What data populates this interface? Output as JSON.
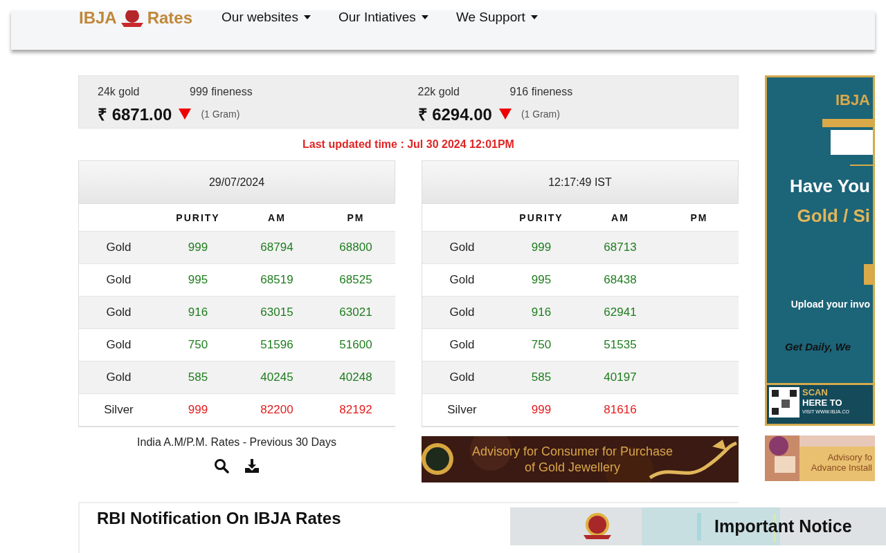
{
  "header": {
    "logo": {
      "left": "IBJA",
      "right": "Rates"
    },
    "nav": [
      {
        "label": "Our websites"
      },
      {
        "label": "Our Intiatives"
      },
      {
        "label": "We Support"
      }
    ]
  },
  "prices": [
    {
      "karat": "24k gold",
      "fineness": "999 fineness",
      "currency": "₹",
      "price": "6871.00",
      "falling": true,
      "unit": "(1 Gram)"
    },
    {
      "karat": "22k gold",
      "fineness": "916 fineness",
      "currency": "₹",
      "price": "6294.00",
      "falling": true,
      "unit": "(1 Gram)"
    }
  ],
  "last_updated": "Last updated time : Jul 30 2024 12:01PM",
  "tables": [
    {
      "title": "29/07/2024",
      "columns": [
        "PURITY",
        "AM",
        "PM"
      ],
      "rows": [
        {
          "metal": "Gold",
          "purity": "999",
          "am": "68794",
          "pm": "68800",
          "color": "#1e7d1e"
        },
        {
          "metal": "Gold",
          "purity": "995",
          "am": "68519",
          "pm": "68525",
          "color": "#1e7d1e"
        },
        {
          "metal": "Gold",
          "purity": "916",
          "am": "63015",
          "pm": "63021",
          "color": "#1e7d1e"
        },
        {
          "metal": "Gold",
          "purity": "750",
          "am": "51596",
          "pm": "51600",
          "color": "#1e7d1e"
        },
        {
          "metal": "Gold",
          "purity": "585",
          "am": "40245",
          "pm": "40248",
          "color": "#1e7d1e"
        },
        {
          "metal": "Silver",
          "purity": "999",
          "am": "82200",
          "pm": "82192",
          "color": "#e41b1b"
        }
      ]
    },
    {
      "title": "12:17:49 IST",
      "columns": [
        "PURITY",
        "AM",
        "PM"
      ],
      "rows": [
        {
          "metal": "Gold",
          "purity": "999",
          "am": "68713",
          "color": "#1e7d1e"
        },
        {
          "metal": "Gold",
          "purity": "995",
          "am": "68438",
          "color": "#1e7d1e"
        },
        {
          "metal": "Gold",
          "purity": "916",
          "am": "62941",
          "color": "#1e7d1e"
        },
        {
          "metal": "Gold",
          "purity": "750",
          "am": "51535",
          "color": "#1e7d1e"
        },
        {
          "metal": "Gold",
          "purity": "585",
          "am": "40197",
          "color": "#1e7d1e"
        },
        {
          "metal": "Silver",
          "purity": "999",
          "am": "81616",
          "color": "#e41b1b"
        }
      ]
    }
  ],
  "previous_rates": {
    "label": "India A.M/P.M. Rates - Previous 30 Days"
  },
  "advisory_banner": {
    "lines": [
      "Advisory for Consumer for Purchase",
      "of Gold Jewellery"
    ]
  },
  "side_ad": {
    "brand": "IBJA",
    "headline": [
      "Have You",
      "Gold / Si"
    ],
    "upload": "Upload your invo",
    "cta": "Get Daily, We",
    "scan": [
      "SCAN",
      "HERE TO"
    ],
    "site": "VISIT WWW.IBJA.CO"
  },
  "side_banner": {
    "lines": [
      "Advisory fo",
      "Advance Install"
    ]
  },
  "rbi_section": {
    "title": "RBI Notification On IBJA Rates"
  },
  "notice_banner": {
    "title": "Important Notice"
  }
}
